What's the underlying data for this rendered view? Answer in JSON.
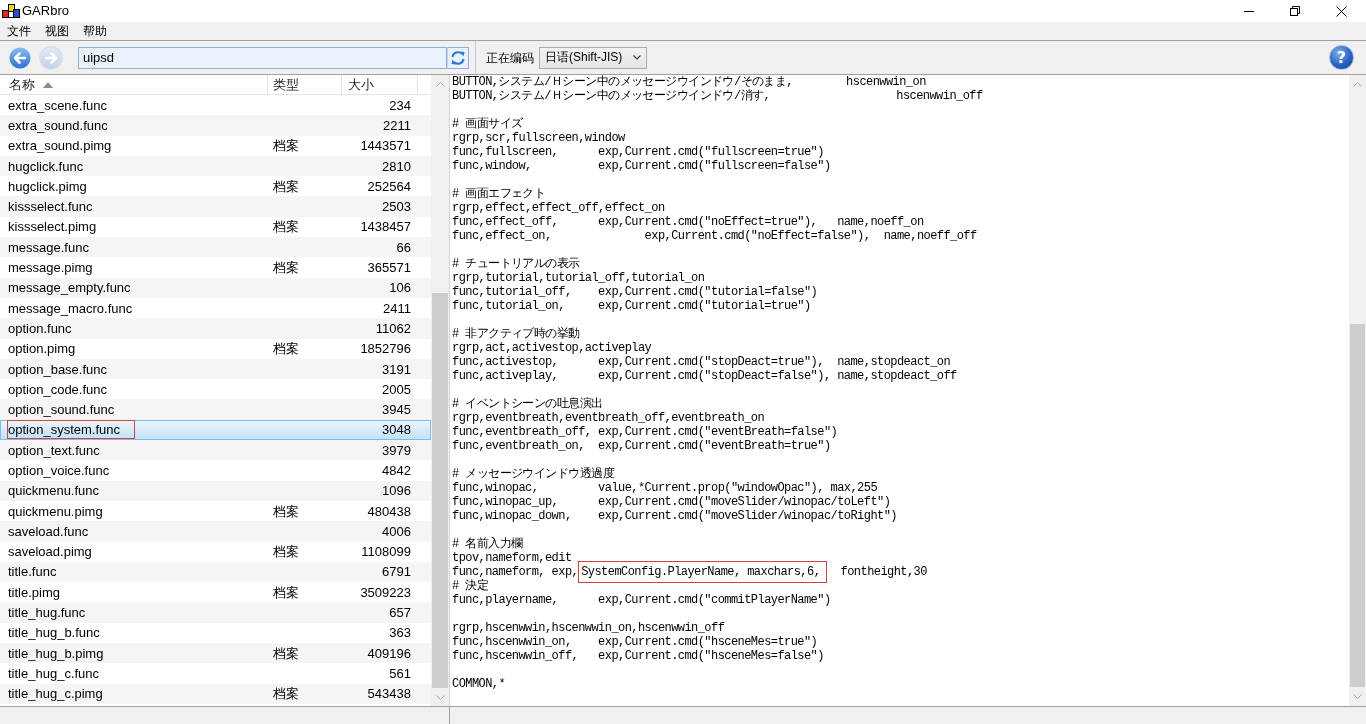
{
  "window": {
    "title": "GARbro"
  },
  "menu": [
    "文件",
    "视图",
    "帮助"
  ],
  "toolbar": {
    "navigation": [
      {
        "kind": "back",
        "disabled": false
      },
      {
        "kind": "forward",
        "disabled": true
      }
    ],
    "path": {
      "value": "uipsd"
    },
    "encoding_label": "正在编码",
    "encoding": {
      "value": "日语(Shift-JIS)"
    },
    "help": {
      "label": "?"
    }
  },
  "file_list": {
    "columns": [
      {
        "label": "名称",
        "sorted_ascending": true
      },
      {
        "label": "类型",
        "sorted_ascending": false
      },
      {
        "label": "大小",
        "sorted_ascending": false
      }
    ],
    "rows": [
      {
        "name": "extra_scene.func",
        "size": "234",
        "selected": false,
        "boxed": false
      },
      {
        "name": "extra_sound.func",
        "size": "2211",
        "selected": false,
        "boxed": false
      },
      {
        "name": "extra_sound.pimg",
        "type": "档案",
        "size": "1443571",
        "selected": false,
        "boxed": false
      },
      {
        "name": "hugclick.func",
        "size": "2810",
        "selected": false,
        "boxed": false
      },
      {
        "name": "hugclick.pimg",
        "type": "档案",
        "size": "252564",
        "selected": false,
        "boxed": false
      },
      {
        "name": "kissselect.func",
        "size": "2503",
        "selected": false,
        "boxed": false
      },
      {
        "name": "kissselect.pimg",
        "type": "档案",
        "size": "1438457",
        "selected": false,
        "boxed": false
      },
      {
        "name": "message.func",
        "size": "66",
        "selected": false,
        "boxed": false
      },
      {
        "name": "message.pimg",
        "type": "档案",
        "size": "365571",
        "selected": false,
        "boxed": false
      },
      {
        "name": "message_empty.func",
        "size": "106",
        "selected": false,
        "boxed": false
      },
      {
        "name": "message_macro.func",
        "size": "2411",
        "selected": false,
        "boxed": false
      },
      {
        "name": "option.func",
        "size": "11062",
        "selected": false,
        "boxed": false
      },
      {
        "name": "option.pimg",
        "type": "档案",
        "size": "1852796",
        "selected": false,
        "boxed": false
      },
      {
        "name": "option_base.func",
        "size": "3191",
        "selected": false,
        "boxed": false
      },
      {
        "name": "option_code.func",
        "size": "2005",
        "selected": false,
        "boxed": false
      },
      {
        "name": "option_sound.func",
        "size": "3945",
        "selected": false,
        "boxed": false
      },
      {
        "name": "option_system.func",
        "size": "3048",
        "selected": true,
        "boxed": true
      },
      {
        "name": "option_text.func",
        "size": "3979",
        "selected": false,
        "boxed": false
      },
      {
        "name": "option_voice.func",
        "size": "4842",
        "selected": false,
        "boxed": false
      },
      {
        "name": "quickmenu.func",
        "size": "1096",
        "selected": false,
        "boxed": false
      },
      {
        "name": "quickmenu.pimg",
        "type": "档案",
        "size": "480438",
        "selected": false,
        "boxed": false
      },
      {
        "name": "saveload.func",
        "size": "4006",
        "selected": false,
        "boxed": false
      },
      {
        "name": "saveload.pimg",
        "type": "档案",
        "size": "1108099",
        "selected": false,
        "boxed": false
      },
      {
        "name": "title.func",
        "size": "6791",
        "selected": false,
        "boxed": false
      },
      {
        "name": "title.pimg",
        "type": "档案",
        "size": "3509223",
        "selected": false,
        "boxed": false
      },
      {
        "name": "title_hug.func",
        "size": "657",
        "selected": false,
        "boxed": false
      },
      {
        "name": "title_hug_b.func",
        "size": "363",
        "selected": false,
        "boxed": false
      },
      {
        "name": "title_hug_b.pimg",
        "type": "档案",
        "size": "409196",
        "selected": false,
        "boxed": false
      },
      {
        "name": "title_hug_c.func",
        "size": "561",
        "selected": false,
        "boxed": false
      },
      {
        "name": "title_hug_c.pimg",
        "type": "档案",
        "size": "543438",
        "selected": false,
        "boxed": false
      }
    ]
  },
  "editor": {
    "lines": [
      {
        "kind": "code",
        "text": "BUTTON,システム/Ｈシーン中のメッセージウインドウ/そのまま,        hscenwwin_on"
      },
      {
        "kind": "code",
        "text": "BUTTON,システム/Ｈシーン中のメッセージウインドウ/消す,                   hscenwwin_off"
      },
      {
        "kind": "blank"
      },
      {
        "kind": "code",
        "text": "# 画面サイズ"
      },
      {
        "kind": "code",
        "text": "rgrp,scr,fullscreen,window"
      },
      {
        "kind": "code",
        "text": "func,fullscreen,      exp,Current.cmd(\"fullscreen=true\")"
      },
      {
        "kind": "code",
        "text": "func,window,          exp,Current.cmd(\"fullscreen=false\")"
      },
      {
        "kind": "blank"
      },
      {
        "kind": "code",
        "text": "# 画面エフェクト"
      },
      {
        "kind": "code",
        "text": "rgrp,effect,effect_off,effect_on"
      },
      {
        "kind": "code",
        "text": "func,effect_off,      exp,Current.cmd(\"noEffect=true\"),   name,noeff_on"
      },
      {
        "kind": "code",
        "text": "func,effect_on,              exp,Current.cmd(\"noEffect=false\"),  name,noeff_off"
      },
      {
        "kind": "blank"
      },
      {
        "kind": "code",
        "text": "# チュートリアルの表示"
      },
      {
        "kind": "code",
        "text": "rgrp,tutorial,tutorial_off,tutorial_on"
      },
      {
        "kind": "code",
        "text": "func,tutorial_off,    exp,Current.cmd(\"tutorial=false\")"
      },
      {
        "kind": "code",
        "text": "func,tutorial_on,     exp,Current.cmd(\"tutorial=true\")"
      },
      {
        "kind": "blank"
      },
      {
        "kind": "code",
        "text": "# 非アクティブ時の挙動"
      },
      {
        "kind": "code",
        "text": "rgrp,act,activestop,activeplay"
      },
      {
        "kind": "code",
        "text": "func,activestop,      exp,Current.cmd(\"stopDeact=true\"),  name,stopdeact_on"
      },
      {
        "kind": "code",
        "text": "func,activeplay,      exp,Current.cmd(\"stopDeact=false\"), name,stopdeact_off"
      },
      {
        "kind": "blank"
      },
      {
        "kind": "code",
        "text": "# イベントシーンの吐息演出"
      },
      {
        "kind": "code",
        "text": "rgrp,eventbreath,eventbreath_off,eventbreath_on"
      },
      {
        "kind": "code",
        "text": "func,eventbreath_off, exp,Current.cmd(\"eventBreath=false\")"
      },
      {
        "kind": "code",
        "text": "func,eventbreath_on,  exp,Current.cmd(\"eventBreath=true\")"
      },
      {
        "kind": "blank"
      },
      {
        "kind": "code",
        "text": "# メッセージウインドウ透過度"
      },
      {
        "kind": "code",
        "text": "func,winopac,         value,*Current.prop(\"windowOpac\"), max,255"
      },
      {
        "kind": "code",
        "text": "func,winopac_up,      exp,Current.cmd(\"moveSlider/winopac/toLeft\")"
      },
      {
        "kind": "code",
        "text": "func,winopac_down,    exp,Current.cmd(\"moveSlider/winopac/toRight\")"
      },
      {
        "kind": "blank"
      },
      {
        "kind": "code",
        "text": "# 名前入力欄"
      },
      {
        "kind": "code",
        "text": "tpov,nameform,edit"
      },
      {
        "kind": "annotated",
        "before": "func,nameform, exp,",
        "boxed": "SystemConfig.PlayerName, maxchars,6,",
        "after": "  fontheight,30"
      },
      {
        "kind": "code",
        "text": "# 決定"
      },
      {
        "kind": "code",
        "text": "func,playername,      exp,Current.cmd(\"commitPlayerName\")"
      },
      {
        "kind": "blank"
      },
      {
        "kind": "code",
        "text": "rgrp,hscenwwin,hscenwwin_on,hscenwwin_off"
      },
      {
        "kind": "code",
        "text": "func,hscenwwin_on,    exp,Current.cmd(\"hsceneMes=true\")"
      },
      {
        "kind": "code",
        "text": "func,hscenwwin_off,   exp,Current.cmd(\"hsceneMes=false\")"
      },
      {
        "kind": "blank"
      },
      {
        "kind": "code",
        "text": "COMMON,*"
      }
    ]
  }
}
